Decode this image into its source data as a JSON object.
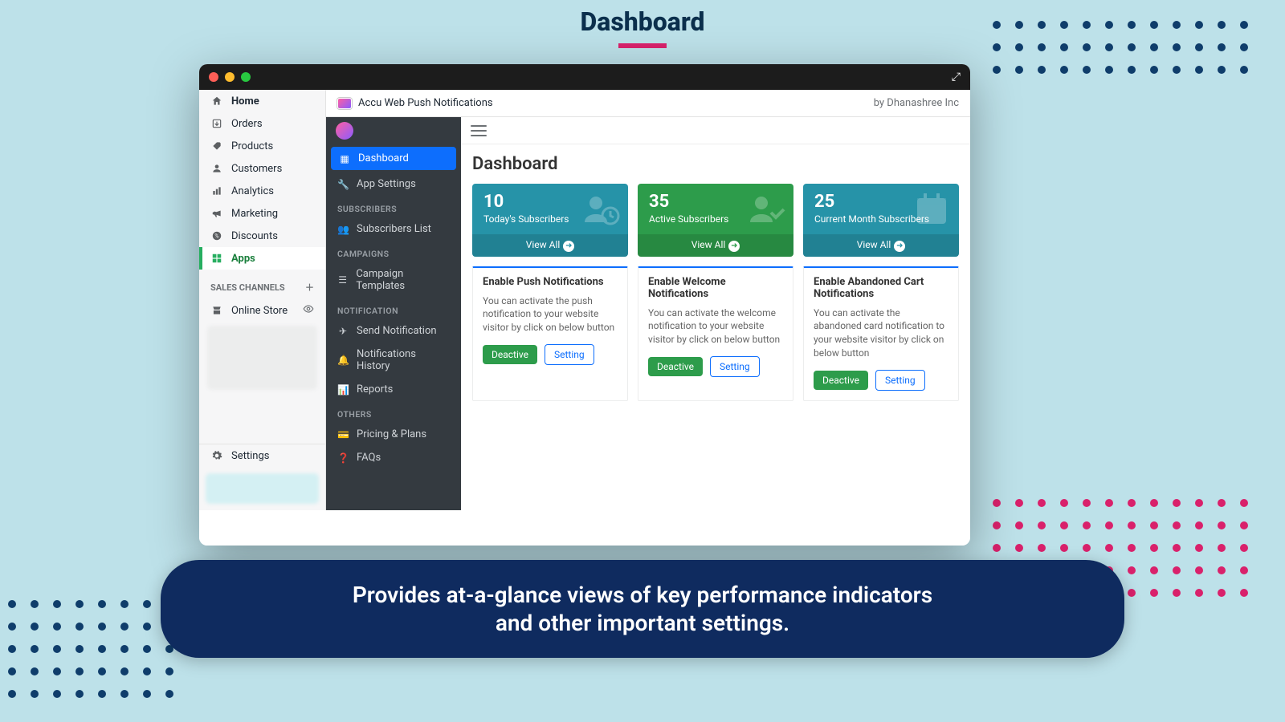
{
  "hero": {
    "title": "Dashboard",
    "caption_line1": "Provides at-a-glance views of key performance indicators",
    "caption_line2": "and other important settings."
  },
  "app_header": {
    "name": "Accu Web Push Notifications",
    "by_prefix": "by ",
    "by_company": "Dhanashree Inc"
  },
  "shopify_nav": {
    "items": [
      {
        "label": "Home",
        "icon": "home-icon"
      },
      {
        "label": "Orders",
        "icon": "orders-icon"
      },
      {
        "label": "Products",
        "icon": "tag-icon"
      },
      {
        "label": "Customers",
        "icon": "user-icon"
      },
      {
        "label": "Analytics",
        "icon": "analytics-icon"
      },
      {
        "label": "Marketing",
        "icon": "megaphone-icon"
      },
      {
        "label": "Discounts",
        "icon": "discount-icon"
      },
      {
        "label": "Apps",
        "icon": "apps-icon",
        "active": true
      }
    ],
    "sales_channels_heading": "SALES CHANNELS",
    "online_store": "Online Store",
    "settings": "Settings"
  },
  "dark_nav": {
    "dashboard": "Dashboard",
    "app_settings": "App Settings",
    "head_subscribers": "SUBSCRIBERS",
    "subscribers_list": "Subscribers List",
    "head_campaigns": "CAMPAIGNS",
    "campaign_templates": "Campaign Templates",
    "head_notification": "NOTIFICATION",
    "send_notification": "Send Notification",
    "notifications_history": "Notifications History",
    "reports": "Reports",
    "head_others": "OTHERS",
    "pricing_plans": "Pricing & Plans",
    "faqs": "FAQs"
  },
  "content": {
    "page_title": "Dashboard",
    "stats": [
      {
        "value": "10",
        "label": "Today's Subscribers",
        "view_all": "View All"
      },
      {
        "value": "35",
        "label": "Active Subscribers",
        "view_all": "View All"
      },
      {
        "value": "25",
        "label": "Current Month Subscribers",
        "view_all": "View All"
      }
    ],
    "cards": [
      {
        "title": "Enable Push Notifications",
        "body": "You can activate the push notification to your website visitor by click on below button",
        "deactive": "Deactive",
        "setting": "Setting"
      },
      {
        "title": "Enable Welcome Notifications",
        "body": "You can activate the welcome notification to your website visitor by click on below button",
        "deactive": "Deactive",
        "setting": "Setting"
      },
      {
        "title": "Enable Abandoned Cart Notifications",
        "body": "You can activate the abandoned card notification to your website visitor by click on below button",
        "deactive": "Deactive",
        "setting": "Setting"
      }
    ]
  }
}
